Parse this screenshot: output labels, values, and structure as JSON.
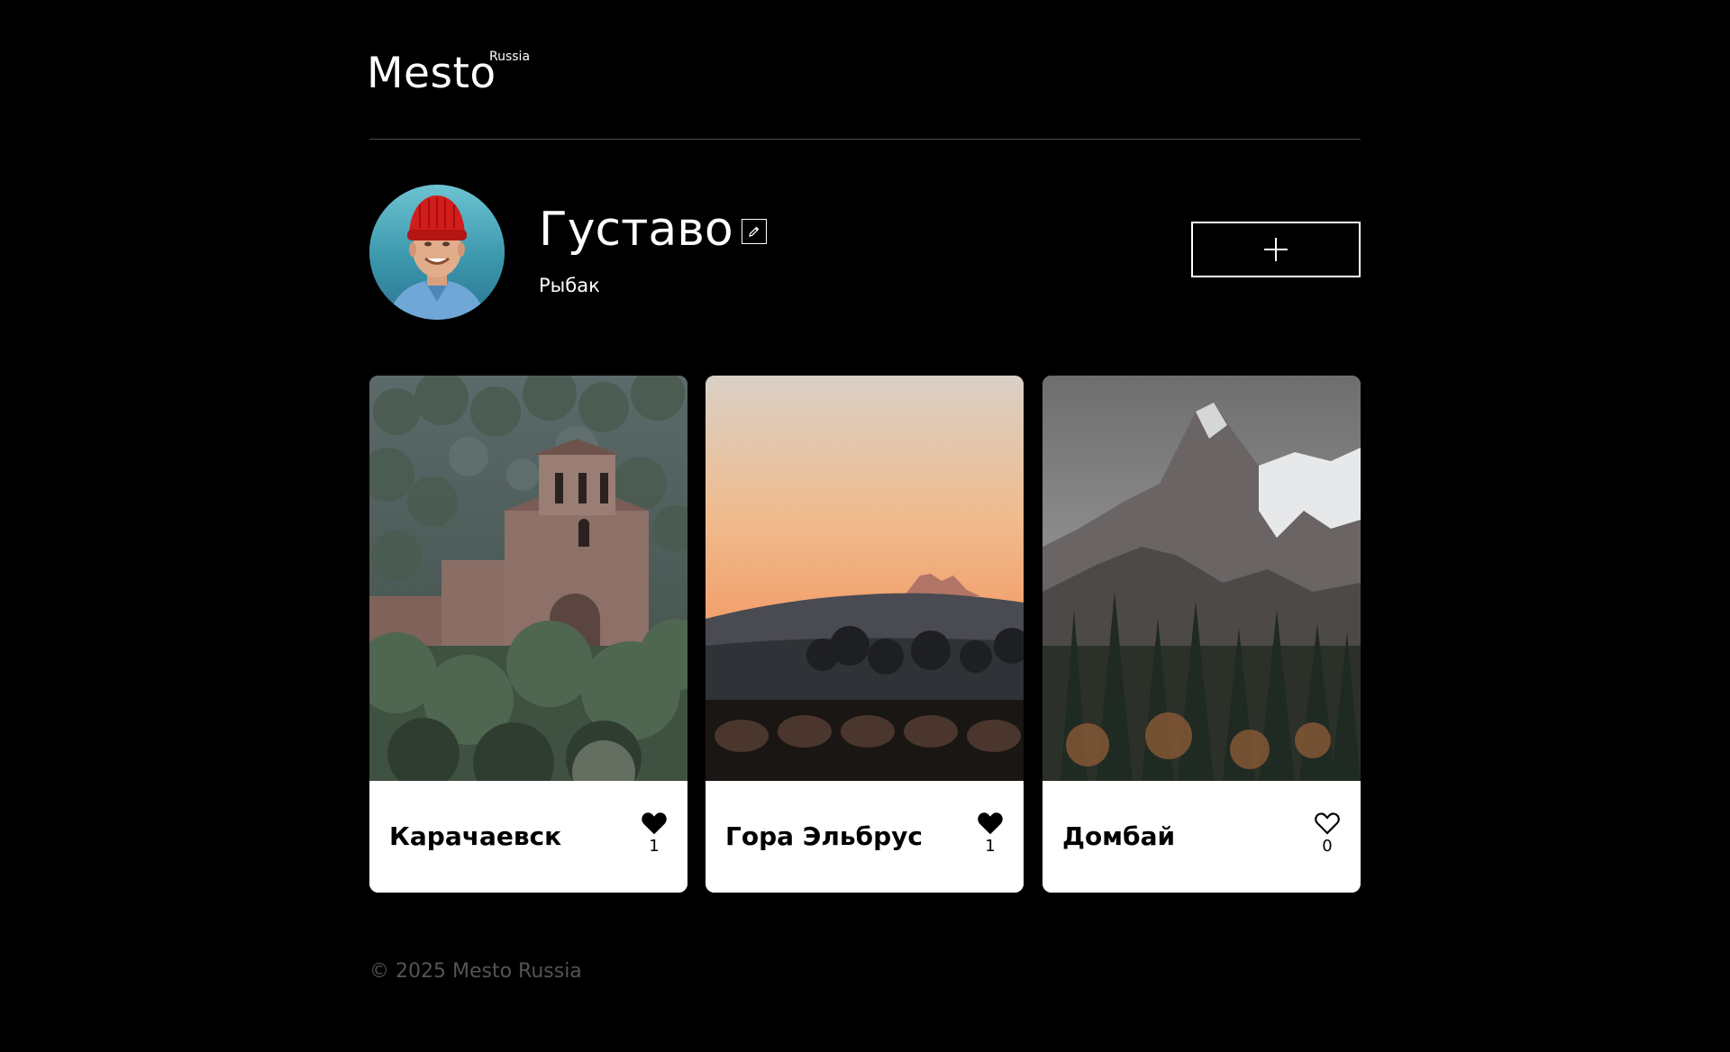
{
  "header": {
    "logo": "Mesto",
    "logo_sup": "Russia"
  },
  "profile": {
    "name": "Густаво",
    "about": "Рыбак",
    "edit_icon": "pencil-icon",
    "add_icon": "plus-icon"
  },
  "cards": [
    {
      "title": "Карачаевск",
      "likes": "1",
      "liked": true
    },
    {
      "title": "Гора Эльбрус",
      "likes": "1",
      "liked": true
    },
    {
      "title": "Домбай",
      "likes": "0",
      "liked": false
    }
  ],
  "footer": {
    "copyright": "© 2025 Mesto Russia"
  },
  "colors": {
    "background": "#000000",
    "text": "#ffffff",
    "card_bg": "#ffffff",
    "footer_text": "#545454"
  }
}
